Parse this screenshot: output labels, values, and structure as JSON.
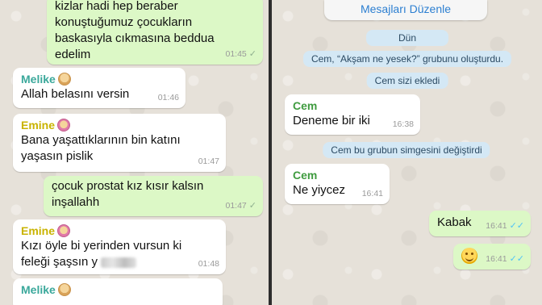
{
  "left_chat": {
    "m1": {
      "lines": [
        "kizlar hadi hep beraber",
        "konuştuğumuz çocukların",
        "baskasıyla cıkmasına beddua",
        "edelim"
      ],
      "time": "01:45"
    },
    "m2": {
      "sender": "Melike",
      "text": "Allah belasını versin",
      "time": "01:46"
    },
    "m3": {
      "sender": "Emine",
      "lines": [
        "Bana yaşattıklarının bin katını",
        "yaşasın pislik"
      ],
      "time": "01:47"
    },
    "m4": {
      "lines": [
        "çocuk prostat kız kısır kalsın",
        "inşallahh"
      ],
      "time": "01:47"
    },
    "m5": {
      "sender": "Emine",
      "lines": [
        "Kızı öyle bi yerinden vursun ki",
        "feleği şaşsın y"
      ],
      "time": "01:48"
    },
    "m6": {
      "sender": "Melike"
    }
  },
  "right_chat": {
    "edit_button": "Mesajları Düzenle",
    "date_pill": "Dün",
    "sys1": "Cem, “Akşam ne yesek?” grubunu oluşturdu.",
    "sys2": "Cem sizi ekledi",
    "m1": {
      "sender": "Cem",
      "text": "Deneme bir iki",
      "time": "16:38"
    },
    "sys3": "Cem bu grubun simgesini değiştirdi",
    "m2": {
      "sender": "Cem",
      "text": "Ne yiycez",
      "time": "16:41"
    },
    "m3": {
      "text": "Kabak",
      "time": "16:41"
    },
    "m4": {
      "emoji": "smile",
      "time": "16:41"
    }
  },
  "colors": {
    "outgoing": "#dcf8c6",
    "incoming": "#ffffff",
    "melike": "#3aa89b",
    "emine": "#c9b300",
    "cem": "#3f9b3f",
    "read_tick": "#4fc3f7"
  }
}
